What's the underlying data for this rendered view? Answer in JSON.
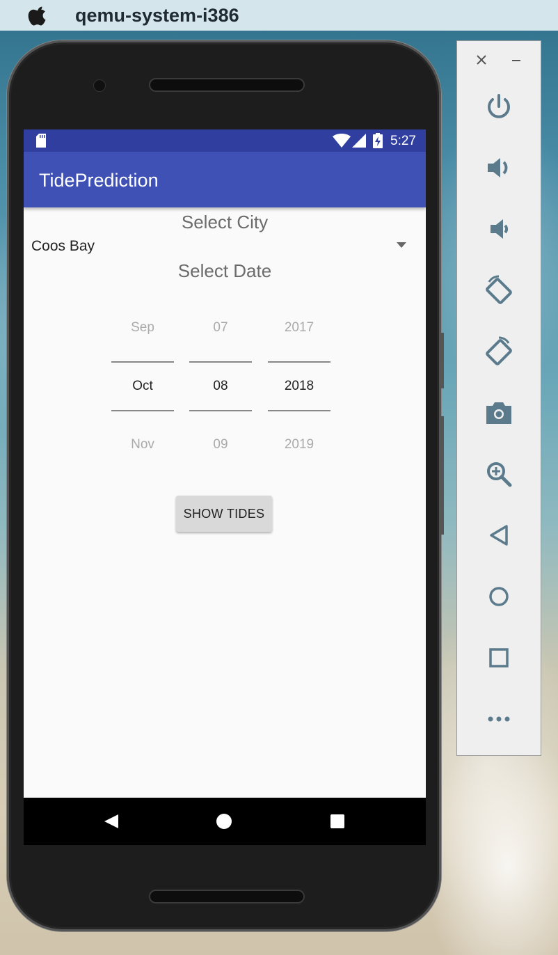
{
  "window": {
    "title": "qemu-system-i386"
  },
  "status_bar": {
    "time": "5:27"
  },
  "app_bar": {
    "title": "TidePrediction"
  },
  "city": {
    "label": "Select City",
    "selected": "Coos Bay"
  },
  "date": {
    "label": "Select Date",
    "month": {
      "prev": "Sep",
      "current": "Oct",
      "next": "Nov"
    },
    "day": {
      "prev": "07",
      "current": "08",
      "next": "09"
    },
    "year": {
      "prev": "2017",
      "current": "2018",
      "next": "2019"
    }
  },
  "show_button": {
    "label": "SHOW TIDES"
  },
  "colors": {
    "status_bar": "#303f9f",
    "app_bar": "#3f51b5",
    "emulator_icon": "#5b7b8c"
  },
  "emulator_controls": [
    "close-icon",
    "minimize-icon",
    "power-icon",
    "volume-up-icon",
    "volume-down-icon",
    "rotate-left-icon",
    "rotate-right-icon",
    "camera-icon",
    "zoom-icon",
    "back-icon",
    "home-icon",
    "overview-icon",
    "more-icon"
  ]
}
